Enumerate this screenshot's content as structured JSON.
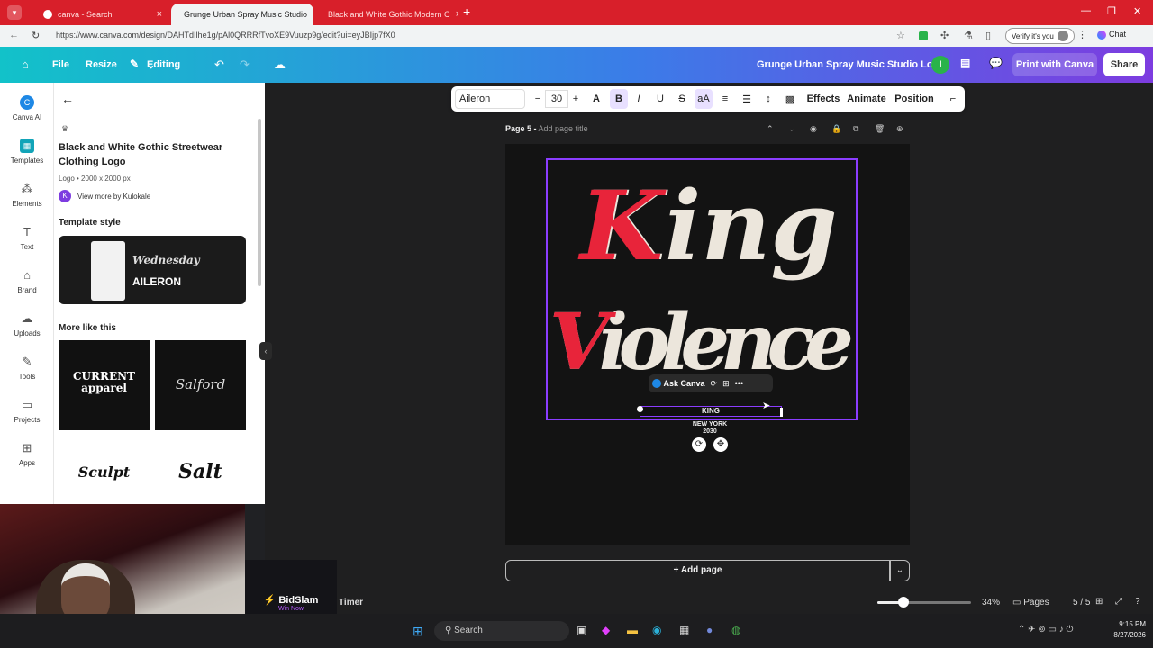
{
  "browser": {
    "tabs": [
      {
        "title": "canva - Search",
        "active": false
      },
      {
        "title": "Grunge Urban Spray Music Studio",
        "active": true
      },
      {
        "title": "Black and White Gothic Modern C",
        "active": false
      }
    ],
    "url": "https://www.canva.com/design/DAHTdIlhe1g/pAl0QRRRfTvoXE9Vuuzp9g/edit?ui=eyJBIjp7fX0",
    "verify_label": "Verify it's you",
    "chat_label": "Chat"
  },
  "header": {
    "file": "File",
    "resize": "Resize",
    "editing": "Editing",
    "design_title": "Grunge Urban Spray Music Studio Logo",
    "avatar_letter": "I",
    "print": "Print with Canva",
    "share": "Share"
  },
  "rail": [
    {
      "label": "Canva AI",
      "icon": "canva-ai-icon"
    },
    {
      "label": "Templates",
      "icon": "templates-icon"
    },
    {
      "label": "Elements",
      "icon": "elements-icon"
    },
    {
      "label": "Text",
      "icon": "text-icon"
    },
    {
      "label": "Brand",
      "icon": "brand-icon"
    },
    {
      "label": "Uploads",
      "icon": "uploads-icon"
    },
    {
      "label": "Tools",
      "icon": "tools-icon"
    },
    {
      "label": "Projects",
      "icon": "projects-icon"
    },
    {
      "label": "Apps",
      "icon": "apps-icon"
    }
  ],
  "panel": {
    "template_title": "Black and White Gothic Streetwear Clothing Logo",
    "template_meta": "Logo • 2000 x 2000 px",
    "author_initial": "K",
    "author_link": "View more by Kulokale",
    "style_heading": "Template style",
    "style_font_script": "Wednesday",
    "style_font_name": "AILERON",
    "more_heading": "More like this",
    "more_items": [
      "CURRENT apparel",
      "Salford",
      "Sculpt",
      "Salt"
    ]
  },
  "toolbar": {
    "font": "Aileron",
    "size": "30",
    "effects": "Effects",
    "animate": "Animate",
    "position": "Position"
  },
  "page": {
    "label": "Page 5 -",
    "add_title": "Add page title"
  },
  "design": {
    "line1": "King",
    "line2": "Violence",
    "ask_canva": "Ask Canva",
    "selected_text": "KING",
    "sub1": "NEW YORK",
    "sub2": "2030"
  },
  "footer": {
    "add_page": "+ Add page",
    "timer": "Timer",
    "zoom": "34%",
    "zoom_level": 0.34,
    "pages": "Pages",
    "page_count": "5 / 5"
  },
  "taskbar": {
    "search": "Search",
    "time": "9:15 PM",
    "date": "8/27/2026"
  },
  "overlay": {
    "brand": "BidSlam",
    "tagline": "Win Now"
  },
  "colors": {
    "tabstrip": "#d81f2a",
    "accent": "#8b3dff",
    "red_script": "#e8243a",
    "cream_script": "#ece6dc"
  }
}
